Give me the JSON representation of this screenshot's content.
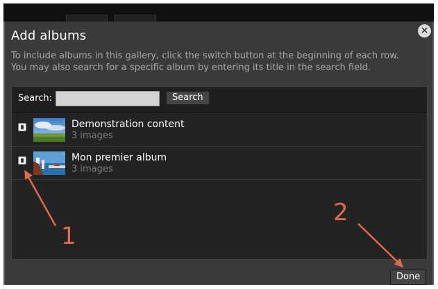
{
  "dialog": {
    "title": "Add albums",
    "close_icon": "close-icon",
    "intro_lines": [
      "To include albums in this gallery, click the switch button at the beginning of each row.",
      "You may also search for a specific album by entering its title in the search field."
    ]
  },
  "search": {
    "label": "Search:",
    "value": "",
    "placeholder": "",
    "button_label": "Search"
  },
  "albums": [
    {
      "title": "Demonstration content",
      "count": "3 images",
      "switch_icon": "switch-icon",
      "thumb": "landscape-thumbnail"
    },
    {
      "title": "Mon premier album",
      "count": "3 images",
      "switch_icon": "switch-icon",
      "thumb": "harbor-thumbnail"
    }
  ],
  "footer": {
    "done_label": "Done"
  },
  "annotations": {
    "label_1": "1",
    "label_2": "2",
    "color": "#e06a4c"
  }
}
